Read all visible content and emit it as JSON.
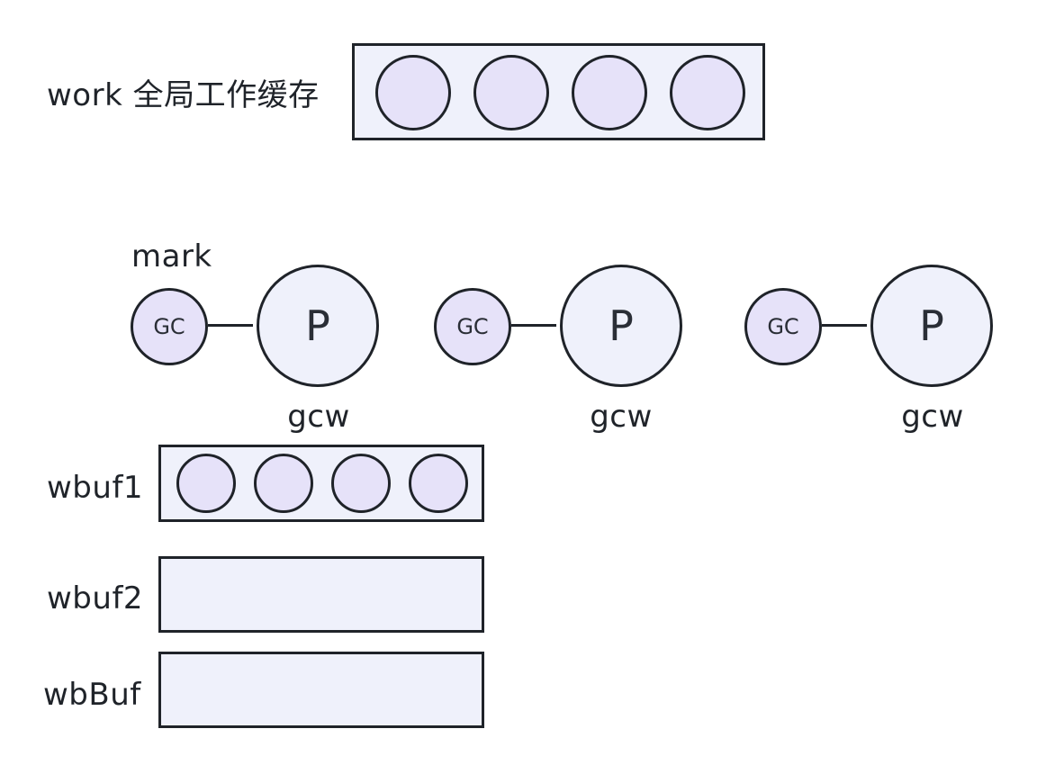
{
  "work_buffer": {
    "label": "work 全局工作缓存",
    "item_count": 4
  },
  "mark_label": "mark",
  "processors": [
    {
      "gc_label": "GC",
      "p_label": "P",
      "gcw_label": "gcw"
    },
    {
      "gc_label": "GC",
      "p_label": "P",
      "gcw_label": "gcw"
    },
    {
      "gc_label": "GC",
      "p_label": "P",
      "gcw_label": "gcw"
    }
  ],
  "buffers": [
    {
      "label": "wbuf1",
      "item_count": 4
    },
    {
      "label": "wbuf2",
      "item_count": 0
    },
    {
      "label": "wbBuf",
      "item_count": 0
    }
  ],
  "colors": {
    "stroke": "#1f2329",
    "container_fill": "#eff1fb",
    "item_fill": "#e6e2f9"
  }
}
